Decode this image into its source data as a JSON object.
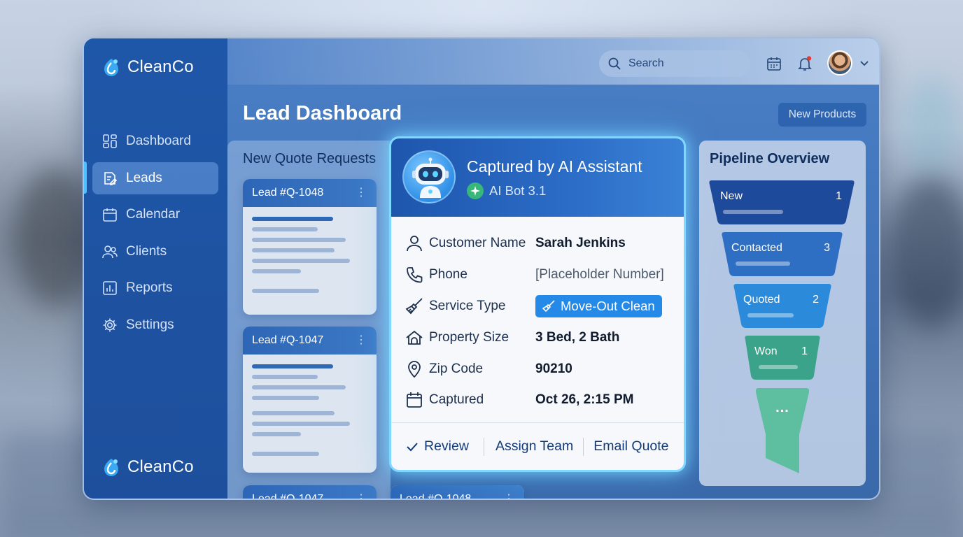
{
  "brand": {
    "name": "CleanCo"
  },
  "sidebar": {
    "items": [
      {
        "label": "Dashboard",
        "icon": "dashboard-grid-icon",
        "active": false
      },
      {
        "label": "Leads",
        "icon": "leads-edit-icon",
        "active": true
      },
      {
        "label": "Calendar",
        "icon": "calendar-icon",
        "active": false
      },
      {
        "label": "Clients",
        "icon": "users-icon",
        "active": false
      },
      {
        "label": "Reports",
        "icon": "bar-chart-icon",
        "active": false
      },
      {
        "label": "Settings",
        "icon": "gear-icon",
        "active": false
      }
    ]
  },
  "header": {
    "search_placeholder": "Search",
    "icons": [
      "calendar-icon",
      "bell-icon",
      "avatar",
      "chevron-down-icon"
    ],
    "notification_dot": true
  },
  "page": {
    "title": "Lead Dashboard",
    "action_label": "New Products"
  },
  "quote_requests": {
    "title": "New Quote Requests",
    "cards": [
      {
        "label": "Lead #Q-1048"
      },
      {
        "label": "Lead #Q-1047"
      },
      {
        "label": "Lead #Q-1047"
      },
      {
        "label": "Lead #Q-1048"
      }
    ]
  },
  "ai_capture": {
    "title": "Captured by AI Assistant",
    "bot_version": "AI Bot 3.1",
    "fields": [
      {
        "label": "Customer Name",
        "value": "Sarah Jenkins",
        "icon": "person-icon"
      },
      {
        "label": "Phone",
        "value": "[Placeholder Number]",
        "icon": "phone-icon"
      },
      {
        "label": "Service Type",
        "value": "Move-Out Clean",
        "icon": "broom-icon"
      },
      {
        "label": "Property Size",
        "value": "3 Bed, 2 Bath",
        "icon": "house-icon"
      },
      {
        "label": "Zip Code",
        "value": "90210",
        "icon": "location-pin-icon"
      },
      {
        "label": "Captured",
        "value": "Oct 26, 2:15 PM",
        "icon": "calendar-icon"
      }
    ],
    "actions": [
      {
        "label": "Review",
        "icon": "check-icon"
      },
      {
        "label": "Assign Team"
      },
      {
        "label": "Email Quote"
      }
    ]
  },
  "pipeline": {
    "title": "Pipeline Overview",
    "stages": [
      {
        "label": "New",
        "count": "1",
        "color": "#1d4a9a"
      },
      {
        "label": "Contacted",
        "count": "3",
        "color": "#2f6fc3"
      },
      {
        "label": "Quoted",
        "count": "2",
        "color": "#2b8ad9"
      },
      {
        "label": "Won",
        "count": "1",
        "color": "#3aa38a"
      }
    ],
    "more_label": "...",
    "more_color": "#5dbf9f"
  },
  "colors": {
    "sidebar_bg": "#1f57a8",
    "accent": "#2589e7",
    "glow": "#7fd8ff",
    "notification": "#e53935"
  }
}
